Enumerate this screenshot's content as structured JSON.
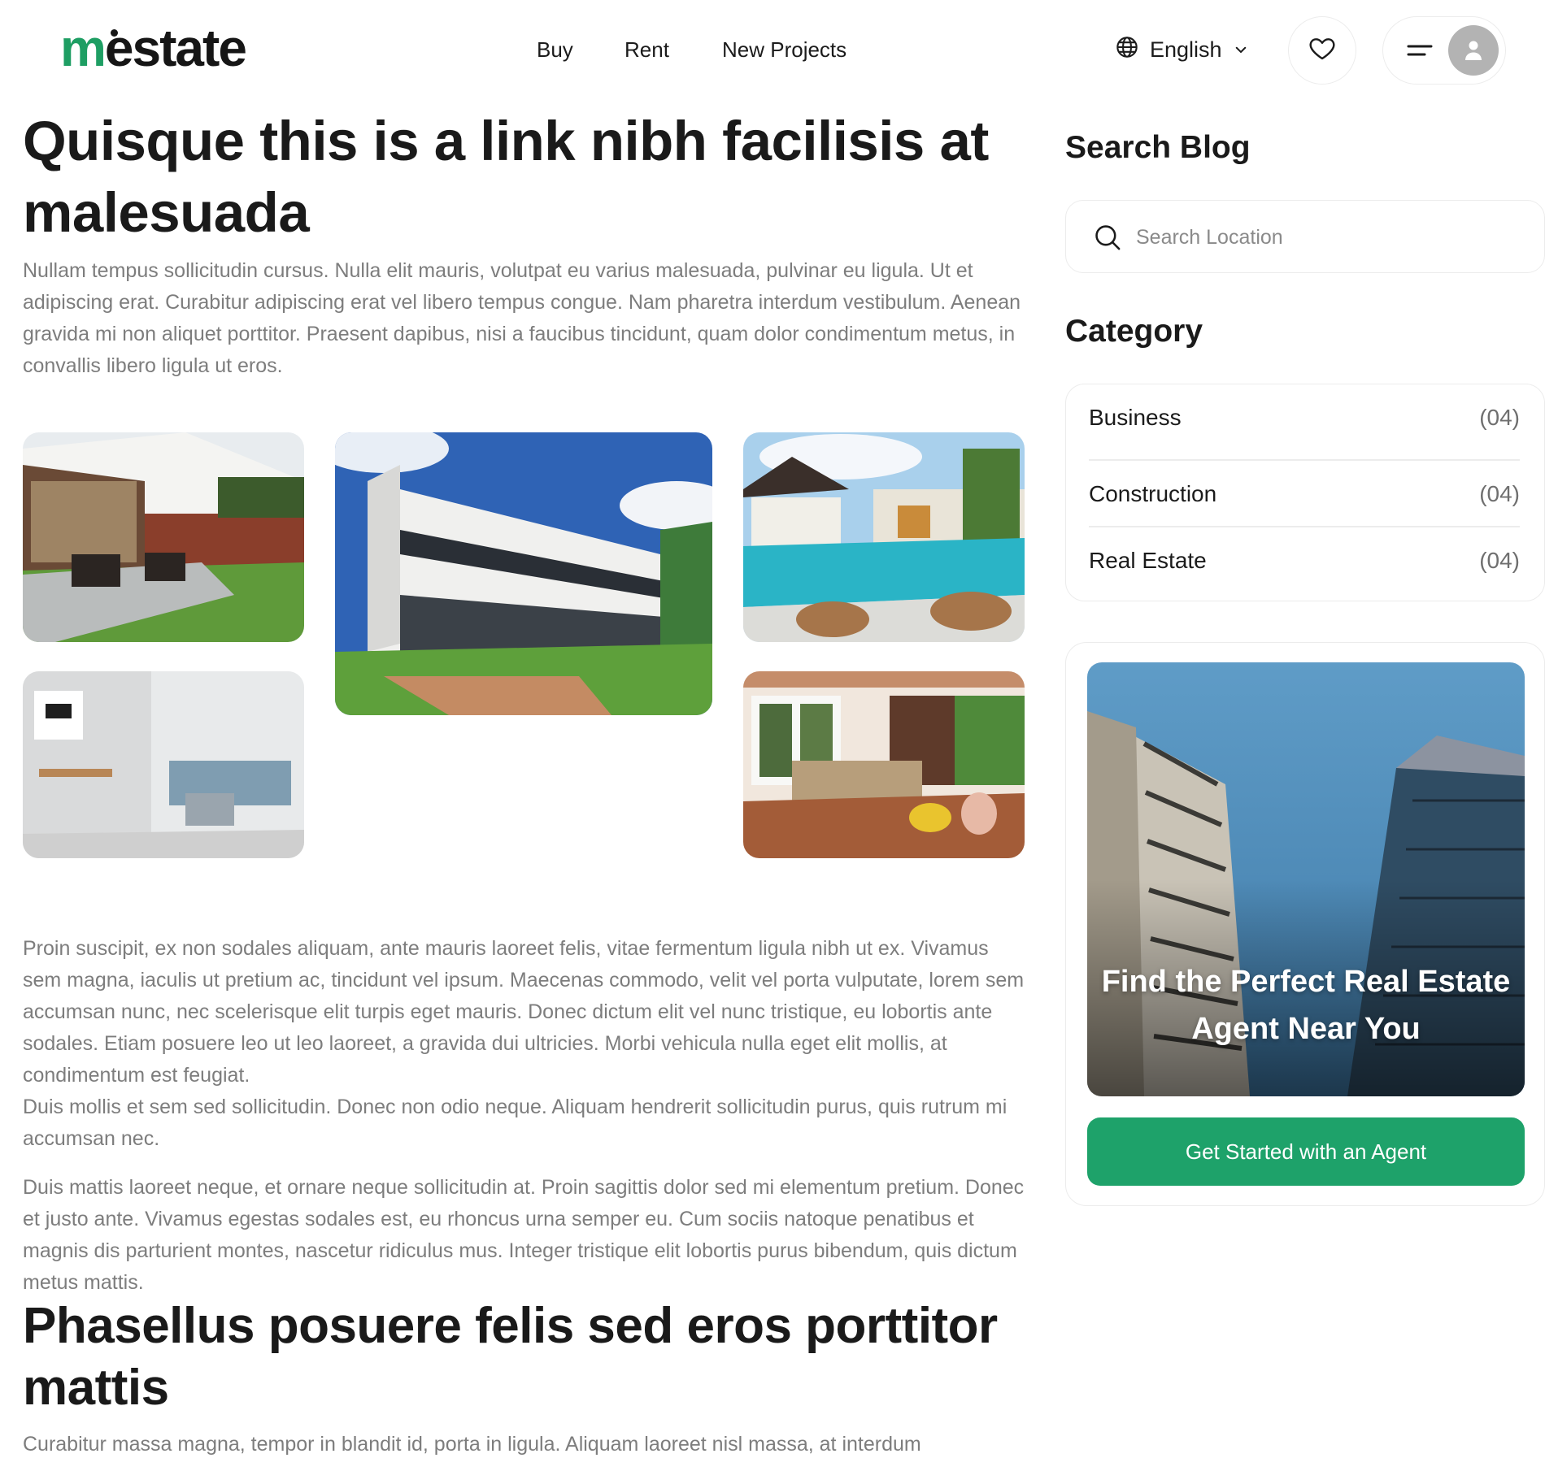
{
  "header": {
    "logo_text": "estate",
    "logo_initial": "m",
    "nav": [
      "Buy",
      "Rent",
      "New Projects"
    ],
    "language": "English"
  },
  "article": {
    "title": "Quisque this is a link nibh facilisis at malesuada",
    "intro": "Nullam tempus sollicitudin cursus. Nulla elit mauris, volutpat eu varius malesuada, pulvinar eu ligula. Ut et adipiscing erat. Curabitur adipiscing erat vel libero tempus congue. Nam pharetra interdum vestibulum. Aenean gravida mi non aliquet porttitor. Praesent dapibus, nisi a faucibus tincidunt, quam dolor condimentum metus, in convallis libero ligula ut eros.",
    "para2": "Proin suscipit, ex non sodales aliquam, ante mauris laoreet felis, vitae fermentum ligula nibh ut ex. Vivamus sem magna, iaculis ut pretium ac, tincidunt vel ipsum. Maecenas commodo, velit vel porta vulputate, lorem sem accumsan nunc, nec scelerisque elit turpis eget mauris. Donec dictum elit vel nunc tristique, eu lobortis ante sodales. Etiam posuere leo ut leo laoreet, a gravida dui ultricies. Morbi vehicula nulla eget elit mollis, at condimentum est feugiat.",
    "para2b": "Duis mollis et sem sed sollicitudin. Donec non odio neque. Aliquam hendrerit sollicitudin purus, quis rutrum mi accumsan nec.",
    "para3": "Duis mattis laoreet neque, et ornare neque sollicitudin at. Proin sagittis dolor sed mi elementum pretium. Donec et justo ante. Vivamus egestas sodales est, eu rhoncus urna semper eu. Cum sociis natoque penatibus et magnis dis parturient montes, nascetur ridiculus mus. Integer tristique elit lobortis purus bibendum, quis dictum metus mattis.",
    "subtitle": "Phasellus posuere felis sed eros porttitor mattis",
    "para4": "Curabitur massa magna, tempor in blandit id, porta in ligula. Aliquam laoreet nisl massa, at interdum"
  },
  "sidebar": {
    "search_title": "Search Blog",
    "search_placeholder": "Search Location",
    "category_title": "Category",
    "categories": [
      {
        "name": "Business",
        "count": "(04)"
      },
      {
        "name": "Construction",
        "count": "(04)"
      },
      {
        "name": "Real Estate",
        "count": "(04)"
      }
    ],
    "promo_text": "Find the Perfect Real Estate Agent Near You",
    "promo_button": "Get Started with an Agent"
  },
  "colors": {
    "brand_green": "#1e9e63",
    "button_green": "#1ea26a",
    "text_dark": "#1a1a1a",
    "text_muted": "#7d7d7d"
  }
}
